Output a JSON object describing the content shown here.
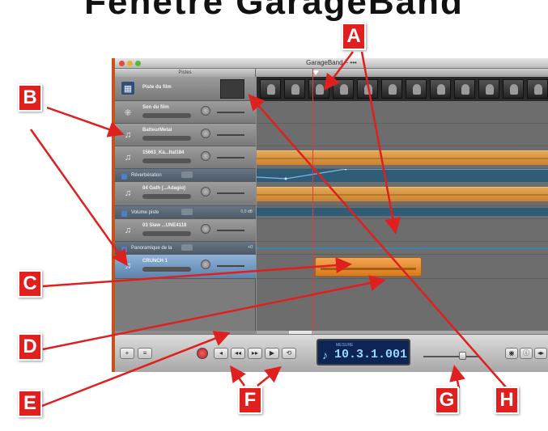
{
  "heading": "Fenêtre GarageBand",
  "window": {
    "title": "GarageBand – •••",
    "tracks_header_label": "Pistes"
  },
  "tracks": [
    {
      "name": "Piste du film",
      "icon": "film-icon",
      "kind": "video"
    },
    {
      "name": "Son du film",
      "icon": "waveform-icon",
      "kind": "audio"
    },
    {
      "name": "BatteurMetal",
      "icon": "instrument-icon",
      "kind": "audio"
    },
    {
      "name": "15663_Ka...Ital184",
      "icon": "instrument-icon",
      "kind": "audio"
    },
    {
      "name": "Réverbération",
      "icon": "automation-icon",
      "kind": "automation"
    },
    {
      "name": "04 Gath (...Adagio)",
      "icon": "instrument-icon",
      "kind": "audio"
    },
    {
      "name": "Volume piste",
      "icon": "automation-icon",
      "kind": "automation",
      "value": "0,0 dB"
    },
    {
      "name": "03 Slaw ...UNE4118",
      "icon": "instrument-icon",
      "kind": "audio"
    },
    {
      "name": "Panoramique de la",
      "icon": "automation-icon",
      "kind": "automation",
      "value": "+0"
    },
    {
      "name": "CRUNCH 1",
      "icon": "instrument-icon",
      "kind": "audio",
      "selected": true
    }
  ],
  "control_bar": {
    "add_track_label": "+",
    "edit_label": "≡",
    "rewind_start": "◂",
    "rewind": "◂◂",
    "forward": "▸▸",
    "play": "▶",
    "cycle": "⟲",
    "lcd_mode": "MESURE",
    "lcd_value": "10.3.1.001",
    "right_buttons": [
      "◉",
      "ⓘ",
      "◂▸"
    ]
  },
  "callouts": [
    "A",
    "A",
    "B",
    "B",
    "C",
    "D",
    "E",
    "F",
    "F",
    "G",
    "H"
  ],
  "colors": {
    "callout_red": "#e01f1f",
    "accent_orange": "#c8501c",
    "region_orange": "#e3a856",
    "automation_blue": "#2f5d78",
    "lcd_blue": "#0c2554"
  }
}
